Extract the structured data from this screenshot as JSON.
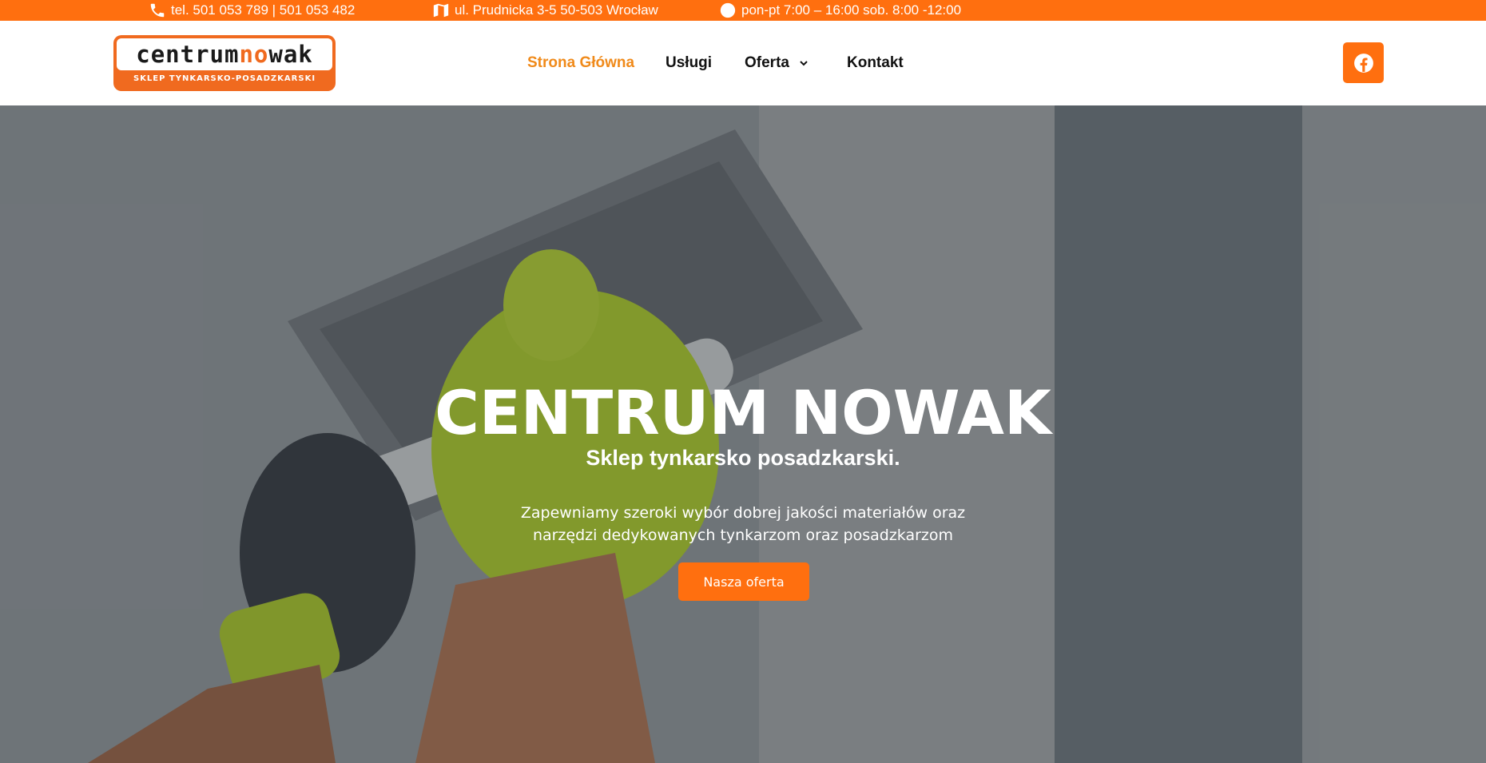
{
  "topbar": {
    "phone": "tel. 501 053 789 | 501 053 482",
    "address": "ul. Prudnicka 3-5 50-503 Wrocław",
    "hours": "pon-pt 7:00 – 16:00 sob. 8:00 -12:00"
  },
  "logo": {
    "word1": "centrum ",
    "word2_accent": "no",
    "word2_rest": "wak",
    "subtitle": "SKLEP TYNKARSKO-POSADZKARSKI"
  },
  "nav": {
    "items": [
      {
        "label": "Strona Główna",
        "active": true
      },
      {
        "label": "Usługi"
      },
      {
        "label": "Oferta",
        "has_dropdown": true
      },
      {
        "label": "Kontakt"
      }
    ]
  },
  "social": {
    "icon": "facebook-icon"
  },
  "hero": {
    "title": "CENTRUM NOWAK",
    "subtitle": "Sklep tynkarsko posadzkarski.",
    "description": "Zapewniamy szeroki wybór dobrej jakości materiałów oraz narzędzi dedykowanych tynkarzom oraz posadzkarzom",
    "button_label": "Nasza oferta"
  },
  "colors": {
    "accent": "#ff6f0f",
    "nav_active": "#f08a1a",
    "text_dark": "#111111"
  }
}
